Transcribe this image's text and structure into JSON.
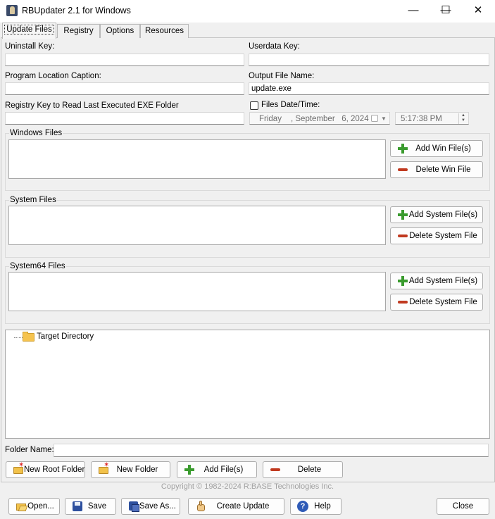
{
  "window": {
    "title": "RBUpdater 2.1 for Windows",
    "minimize": "—",
    "maximize": "☐",
    "close": "✕"
  },
  "tabs": [
    {
      "label": "Update Files",
      "active": true
    },
    {
      "label": "Registry"
    },
    {
      "label": "Options"
    },
    {
      "label": "Resources"
    }
  ],
  "fields": {
    "uninstall_key": {
      "label": "Uninstall Key:",
      "value": ""
    },
    "userdata_key": {
      "label": "Userdata Key:",
      "value": ""
    },
    "program_location": {
      "label": "Program Location Caption:",
      "value": ""
    },
    "output_file": {
      "label": "Output File Name:",
      "value": "update.exe"
    },
    "registry_key": {
      "label": "Registry Key to Read Last Executed EXE Folder",
      "value": ""
    },
    "files_date_time": {
      "label": "Files Date/Time:",
      "checked": false,
      "day": "Friday",
      "date": ", September   6, 2024",
      "time": "5:17:38 PM"
    }
  },
  "groups": {
    "windows": {
      "title": "Windows Files",
      "add": "Add Win File(s)",
      "delete": "Delete Win File"
    },
    "system": {
      "title": "System Files",
      "add": "Add System File(s)",
      "delete": "Delete System File"
    },
    "system64": {
      "title": "System64 Files",
      "add": "Add System File(s)",
      "delete": "Delete System File"
    }
  },
  "tree": {
    "root": "Target Directory"
  },
  "folder": {
    "label": "Folder Name:",
    "value": ""
  },
  "folder_buttons": {
    "new_root": "New Root Folder",
    "new_folder": "New Folder",
    "add_files": "Add File(s)",
    "delete": "Delete"
  },
  "copyright": "Copyright © 1982-2024 R:BASE Technologies Inc.",
  "bottom_buttons": {
    "open": "Open...",
    "save": "Save",
    "save_as": "Save As...",
    "create": "Create Update",
    "help": "Help",
    "close": "Close"
  },
  "colors": {
    "accent_plus": "#3a9b2e",
    "accent_minus": "#c0391f"
  }
}
